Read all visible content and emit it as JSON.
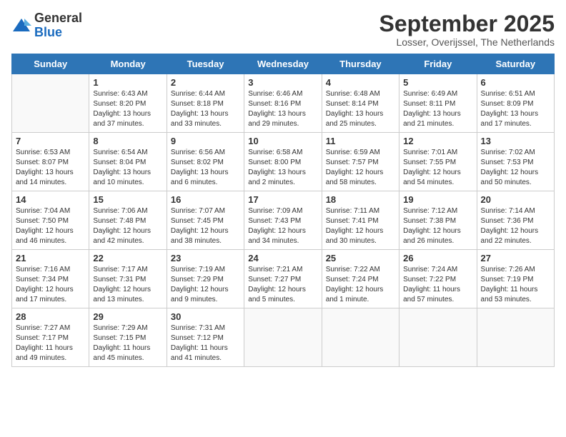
{
  "logo": {
    "general": "General",
    "blue": "Blue"
  },
  "header": {
    "month_year": "September 2025",
    "location": "Losser, Overijssel, The Netherlands"
  },
  "weekdays": [
    "Sunday",
    "Monday",
    "Tuesday",
    "Wednesday",
    "Thursday",
    "Friday",
    "Saturday"
  ],
  "weeks": [
    [
      {
        "day": "",
        "info": ""
      },
      {
        "day": "1",
        "info": "Sunrise: 6:43 AM\nSunset: 8:20 PM\nDaylight: 13 hours\nand 37 minutes."
      },
      {
        "day": "2",
        "info": "Sunrise: 6:44 AM\nSunset: 8:18 PM\nDaylight: 13 hours\nand 33 minutes."
      },
      {
        "day": "3",
        "info": "Sunrise: 6:46 AM\nSunset: 8:16 PM\nDaylight: 13 hours\nand 29 minutes."
      },
      {
        "day": "4",
        "info": "Sunrise: 6:48 AM\nSunset: 8:14 PM\nDaylight: 13 hours\nand 25 minutes."
      },
      {
        "day": "5",
        "info": "Sunrise: 6:49 AM\nSunset: 8:11 PM\nDaylight: 13 hours\nand 21 minutes."
      },
      {
        "day": "6",
        "info": "Sunrise: 6:51 AM\nSunset: 8:09 PM\nDaylight: 13 hours\nand 17 minutes."
      }
    ],
    [
      {
        "day": "7",
        "info": "Sunrise: 6:53 AM\nSunset: 8:07 PM\nDaylight: 13 hours\nand 14 minutes."
      },
      {
        "day": "8",
        "info": "Sunrise: 6:54 AM\nSunset: 8:04 PM\nDaylight: 13 hours\nand 10 minutes."
      },
      {
        "day": "9",
        "info": "Sunrise: 6:56 AM\nSunset: 8:02 PM\nDaylight: 13 hours\nand 6 minutes."
      },
      {
        "day": "10",
        "info": "Sunrise: 6:58 AM\nSunset: 8:00 PM\nDaylight: 13 hours\nand 2 minutes."
      },
      {
        "day": "11",
        "info": "Sunrise: 6:59 AM\nSunset: 7:57 PM\nDaylight: 12 hours\nand 58 minutes."
      },
      {
        "day": "12",
        "info": "Sunrise: 7:01 AM\nSunset: 7:55 PM\nDaylight: 12 hours\nand 54 minutes."
      },
      {
        "day": "13",
        "info": "Sunrise: 7:02 AM\nSunset: 7:53 PM\nDaylight: 12 hours\nand 50 minutes."
      }
    ],
    [
      {
        "day": "14",
        "info": "Sunrise: 7:04 AM\nSunset: 7:50 PM\nDaylight: 12 hours\nand 46 minutes."
      },
      {
        "day": "15",
        "info": "Sunrise: 7:06 AM\nSunset: 7:48 PM\nDaylight: 12 hours\nand 42 minutes."
      },
      {
        "day": "16",
        "info": "Sunrise: 7:07 AM\nSunset: 7:45 PM\nDaylight: 12 hours\nand 38 minutes."
      },
      {
        "day": "17",
        "info": "Sunrise: 7:09 AM\nSunset: 7:43 PM\nDaylight: 12 hours\nand 34 minutes."
      },
      {
        "day": "18",
        "info": "Sunrise: 7:11 AM\nSunset: 7:41 PM\nDaylight: 12 hours\nand 30 minutes."
      },
      {
        "day": "19",
        "info": "Sunrise: 7:12 AM\nSunset: 7:38 PM\nDaylight: 12 hours\nand 26 minutes."
      },
      {
        "day": "20",
        "info": "Sunrise: 7:14 AM\nSunset: 7:36 PM\nDaylight: 12 hours\nand 22 minutes."
      }
    ],
    [
      {
        "day": "21",
        "info": "Sunrise: 7:16 AM\nSunset: 7:34 PM\nDaylight: 12 hours\nand 17 minutes."
      },
      {
        "day": "22",
        "info": "Sunrise: 7:17 AM\nSunset: 7:31 PM\nDaylight: 12 hours\nand 13 minutes."
      },
      {
        "day": "23",
        "info": "Sunrise: 7:19 AM\nSunset: 7:29 PM\nDaylight: 12 hours\nand 9 minutes."
      },
      {
        "day": "24",
        "info": "Sunrise: 7:21 AM\nSunset: 7:27 PM\nDaylight: 12 hours\nand 5 minutes."
      },
      {
        "day": "25",
        "info": "Sunrise: 7:22 AM\nSunset: 7:24 PM\nDaylight: 12 hours\nand 1 minute."
      },
      {
        "day": "26",
        "info": "Sunrise: 7:24 AM\nSunset: 7:22 PM\nDaylight: 11 hours\nand 57 minutes."
      },
      {
        "day": "27",
        "info": "Sunrise: 7:26 AM\nSunset: 7:19 PM\nDaylight: 11 hours\nand 53 minutes."
      }
    ],
    [
      {
        "day": "28",
        "info": "Sunrise: 7:27 AM\nSunset: 7:17 PM\nDaylight: 11 hours\nand 49 minutes."
      },
      {
        "day": "29",
        "info": "Sunrise: 7:29 AM\nSunset: 7:15 PM\nDaylight: 11 hours\nand 45 minutes."
      },
      {
        "day": "30",
        "info": "Sunrise: 7:31 AM\nSunset: 7:12 PM\nDaylight: 11 hours\nand 41 minutes."
      },
      {
        "day": "",
        "info": ""
      },
      {
        "day": "",
        "info": ""
      },
      {
        "day": "",
        "info": ""
      },
      {
        "day": "",
        "info": ""
      }
    ]
  ]
}
